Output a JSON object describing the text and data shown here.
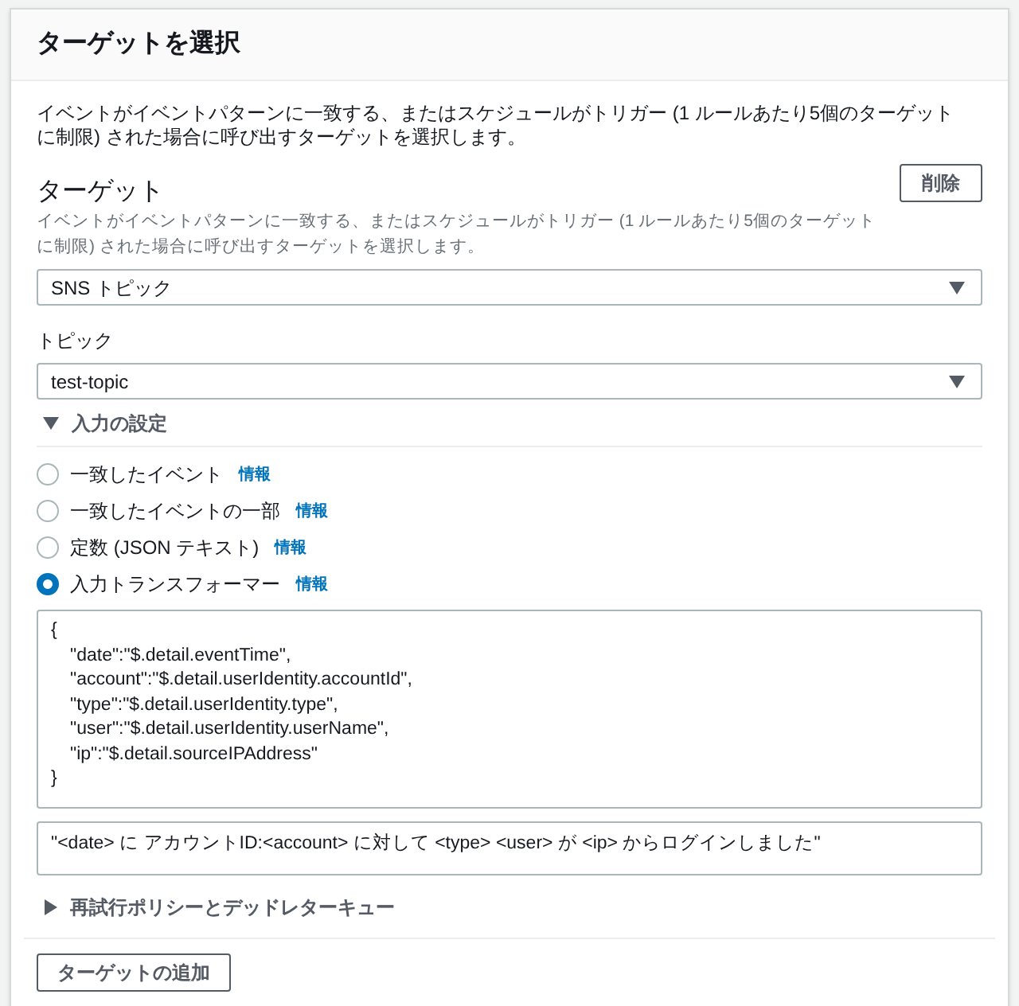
{
  "panel": {
    "title": "ターゲットを選択",
    "description": "イベントがイベントパターンに一致する、またはスケジュールがトリガー (1 ルールあたり5個のターゲットに制限) された場合に呼び出すターゲットを選択します。"
  },
  "target": {
    "label": "ターゲット",
    "description": "イベントがイベントパターンに一致する、またはスケジュールがトリガー (1 ルールあたり5個のターゲットに制限) された場合に呼び出すターゲットを選択します。",
    "remove_button": "削除",
    "select_value": "SNS トピック"
  },
  "topic": {
    "label": "トピック",
    "select_value": "test-topic"
  },
  "input_settings": {
    "label": "入力の設定",
    "expanded": true,
    "options": [
      {
        "label": "一致したイベント",
        "info": "情報",
        "selected": false
      },
      {
        "label": "一致したイベントの一部",
        "info": "情報",
        "selected": false
      },
      {
        "label": "定数 (JSON テキスト)",
        "info": "情報",
        "selected": false
      },
      {
        "label": "入力トランスフォーマー",
        "info": "情報",
        "selected": true
      }
    ],
    "input_paths": [
      {
        "text": "{",
        "indented": false
      },
      {
        "text": "\"date\":\"$.detail.eventTime\",",
        "indented": true
      },
      {
        "text": "\"account\":\"$.detail.userIdentity.accountId\",",
        "indented": true
      },
      {
        "text": "\"type\":\"$.detail.userIdentity.type\",",
        "indented": true
      },
      {
        "text": "\"user\":\"$.detail.userIdentity.userName\",",
        "indented": true
      },
      {
        "text": "\"ip\":\"$.detail.sourceIPAddress\"",
        "indented": true
      },
      {
        "text": "}",
        "indented": false
      }
    ],
    "template": "\"<date> に アカウントID:<account> に対して <type> <user> が <ip> からログインしました\""
  },
  "retry_section": {
    "label": "再試行ポリシーとデッドレターキュー",
    "expanded": false
  },
  "add_target_button": "ターゲットの追加"
}
